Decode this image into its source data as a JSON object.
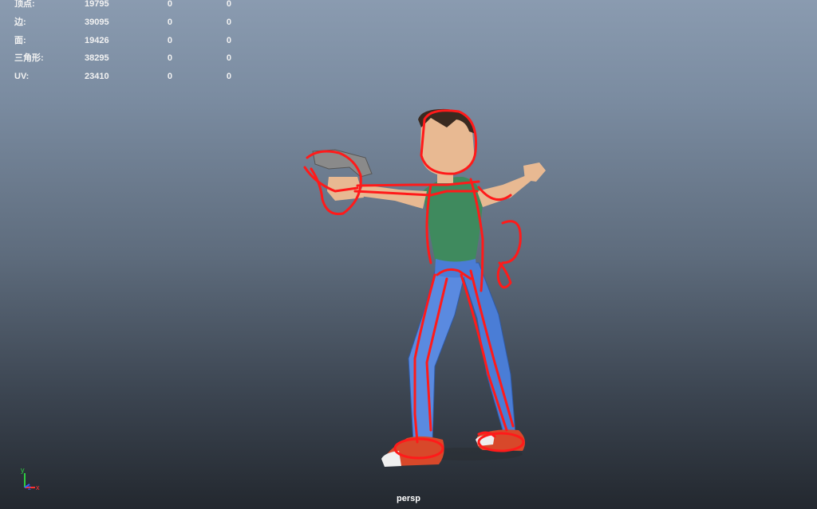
{
  "hud": {
    "rows": [
      {
        "label": "顶点:",
        "total": "19795",
        "selected": "0",
        "component": "0"
      },
      {
        "label": "边:",
        "total": "39095",
        "selected": "0",
        "component": "0"
      },
      {
        "label": "面:",
        "total": "19426",
        "selected": "0",
        "component": "0"
      },
      {
        "label": "三角形:",
        "total": "38295",
        "selected": "0",
        "component": "0"
      },
      {
        "label": "UV:",
        "total": "23410",
        "selected": "0",
        "component": "0"
      }
    ]
  },
  "axis": {
    "y_label": "y",
    "x_label": "x",
    "z_label": "z"
  },
  "camera": {
    "name": "persp"
  },
  "colors": {
    "sketch": "#ff1a1a",
    "skin": "#e8b992",
    "shirt": "#3f8a5e",
    "jeans": "#4a7dd6",
    "shoes": "#d8482a",
    "hair": "#3a2a20"
  }
}
